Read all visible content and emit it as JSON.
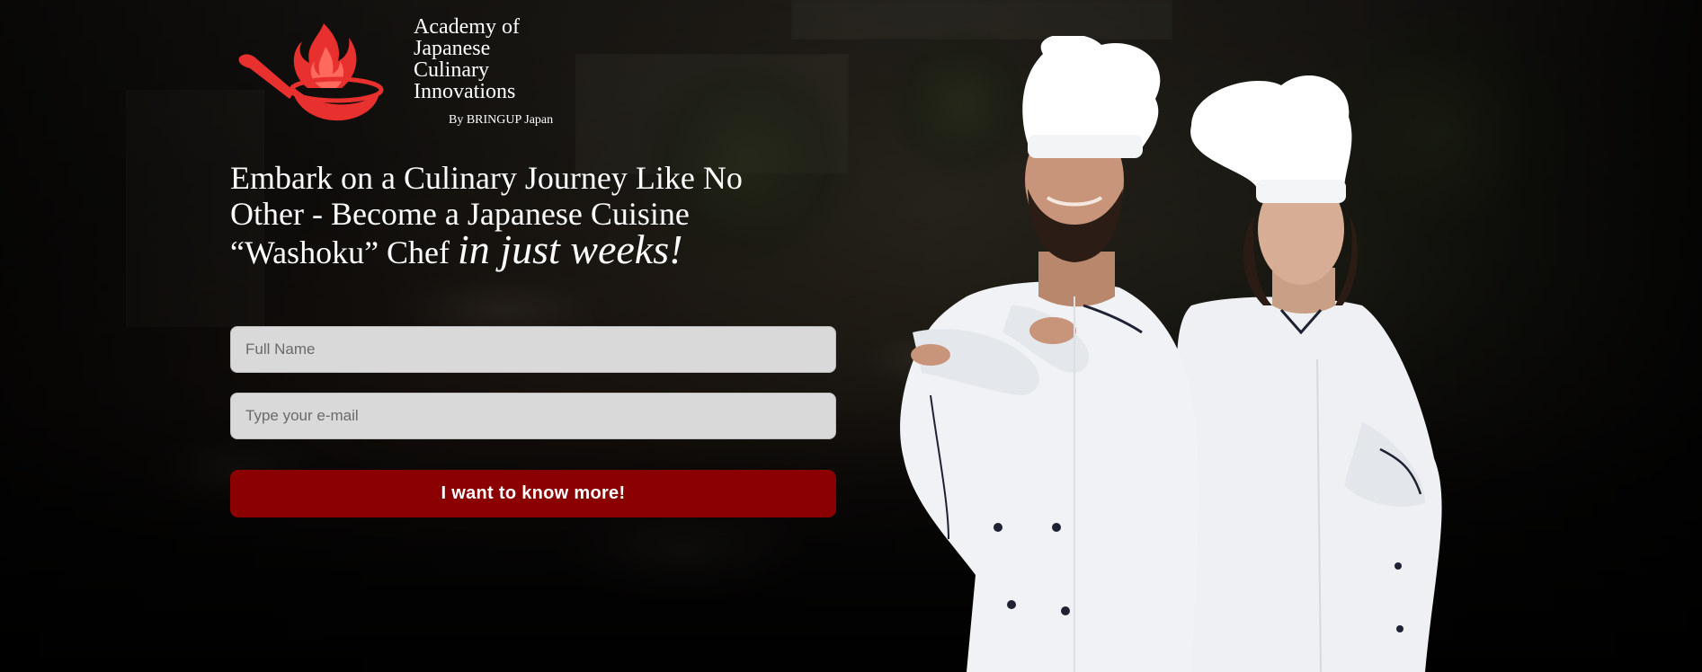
{
  "logo": {
    "line1": "Academy of",
    "line2": "Japanese",
    "line3": "Culinary",
    "line4": "Innovations",
    "byline": "By BRINGUP Japan",
    "icon": "flaming-pan-icon"
  },
  "hero": {
    "headline_main": "Embark on a Culinary Journey Like No Other - Become a Japanese Cuisine “Washoku” Chef ",
    "headline_emphasis": "in just weeks!"
  },
  "form": {
    "name_placeholder": "Full Name",
    "name_value": "",
    "email_placeholder": "Type your e-mail",
    "email_value": "",
    "submit_label": "I want to know more!"
  },
  "colors": {
    "cta": "#8b0000",
    "field_bg": "#d9d9d9",
    "logo_red": "#e8302e",
    "text": "#ffffff"
  },
  "image": {
    "chefs": "two-chefs-crossed-arms-photo"
  }
}
